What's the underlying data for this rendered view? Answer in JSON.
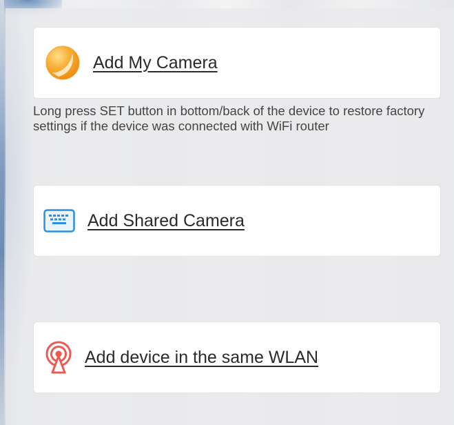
{
  "cards": [
    {
      "label": "Add My Camera",
      "icon": "orange-circle-icon"
    },
    {
      "label": "Add Shared Camera",
      "icon": "keyboard-icon"
    },
    {
      "label": "Add device in the same WLAN",
      "icon": "wlan-signal-icon"
    }
  ],
  "hint_text": "Long press SET button in bottom/back of the device to restore factory settings if the device was connected with WiFi router",
  "colors": {
    "orange_accent": "#f39a1e",
    "keyboard_blue": "#2a8fe0",
    "wlan_red": "#ec5a52"
  }
}
